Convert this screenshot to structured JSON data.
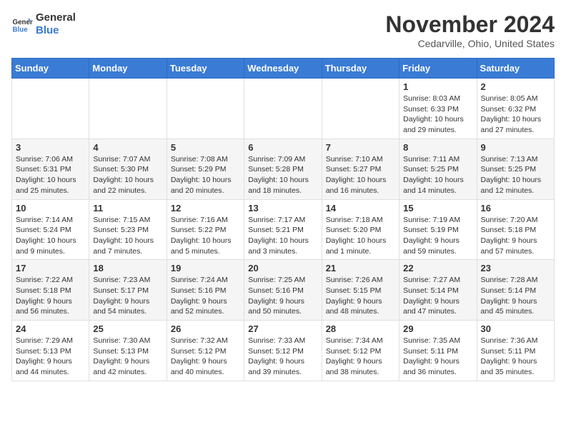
{
  "logo": {
    "text_general": "General",
    "text_blue": "Blue"
  },
  "header": {
    "month_year": "November 2024",
    "location": "Cedarville, Ohio, United States"
  },
  "weekdays": [
    "Sunday",
    "Monday",
    "Tuesday",
    "Wednesday",
    "Thursday",
    "Friday",
    "Saturday"
  ],
  "weeks": [
    [
      {
        "day": "",
        "info": ""
      },
      {
        "day": "",
        "info": ""
      },
      {
        "day": "",
        "info": ""
      },
      {
        "day": "",
        "info": ""
      },
      {
        "day": "",
        "info": ""
      },
      {
        "day": "1",
        "info": "Sunrise: 8:03 AM\nSunset: 6:33 PM\nDaylight: 10 hours and 29 minutes."
      },
      {
        "day": "2",
        "info": "Sunrise: 8:05 AM\nSunset: 6:32 PM\nDaylight: 10 hours and 27 minutes."
      }
    ],
    [
      {
        "day": "3",
        "info": "Sunrise: 7:06 AM\nSunset: 5:31 PM\nDaylight: 10 hours and 25 minutes."
      },
      {
        "day": "4",
        "info": "Sunrise: 7:07 AM\nSunset: 5:30 PM\nDaylight: 10 hours and 22 minutes."
      },
      {
        "day": "5",
        "info": "Sunrise: 7:08 AM\nSunset: 5:29 PM\nDaylight: 10 hours and 20 minutes."
      },
      {
        "day": "6",
        "info": "Sunrise: 7:09 AM\nSunset: 5:28 PM\nDaylight: 10 hours and 18 minutes."
      },
      {
        "day": "7",
        "info": "Sunrise: 7:10 AM\nSunset: 5:27 PM\nDaylight: 10 hours and 16 minutes."
      },
      {
        "day": "8",
        "info": "Sunrise: 7:11 AM\nSunset: 5:25 PM\nDaylight: 10 hours and 14 minutes."
      },
      {
        "day": "9",
        "info": "Sunrise: 7:13 AM\nSunset: 5:25 PM\nDaylight: 10 hours and 12 minutes."
      }
    ],
    [
      {
        "day": "10",
        "info": "Sunrise: 7:14 AM\nSunset: 5:24 PM\nDaylight: 10 hours and 9 minutes."
      },
      {
        "day": "11",
        "info": "Sunrise: 7:15 AM\nSunset: 5:23 PM\nDaylight: 10 hours and 7 minutes."
      },
      {
        "day": "12",
        "info": "Sunrise: 7:16 AM\nSunset: 5:22 PM\nDaylight: 10 hours and 5 minutes."
      },
      {
        "day": "13",
        "info": "Sunrise: 7:17 AM\nSunset: 5:21 PM\nDaylight: 10 hours and 3 minutes."
      },
      {
        "day": "14",
        "info": "Sunrise: 7:18 AM\nSunset: 5:20 PM\nDaylight: 10 hours and 1 minute."
      },
      {
        "day": "15",
        "info": "Sunrise: 7:19 AM\nSunset: 5:19 PM\nDaylight: 9 hours and 59 minutes."
      },
      {
        "day": "16",
        "info": "Sunrise: 7:20 AM\nSunset: 5:18 PM\nDaylight: 9 hours and 57 minutes."
      }
    ],
    [
      {
        "day": "17",
        "info": "Sunrise: 7:22 AM\nSunset: 5:18 PM\nDaylight: 9 hours and 56 minutes."
      },
      {
        "day": "18",
        "info": "Sunrise: 7:23 AM\nSunset: 5:17 PM\nDaylight: 9 hours and 54 minutes."
      },
      {
        "day": "19",
        "info": "Sunrise: 7:24 AM\nSunset: 5:16 PM\nDaylight: 9 hours and 52 minutes."
      },
      {
        "day": "20",
        "info": "Sunrise: 7:25 AM\nSunset: 5:16 PM\nDaylight: 9 hours and 50 minutes."
      },
      {
        "day": "21",
        "info": "Sunrise: 7:26 AM\nSunset: 5:15 PM\nDaylight: 9 hours and 48 minutes."
      },
      {
        "day": "22",
        "info": "Sunrise: 7:27 AM\nSunset: 5:14 PM\nDaylight: 9 hours and 47 minutes."
      },
      {
        "day": "23",
        "info": "Sunrise: 7:28 AM\nSunset: 5:14 PM\nDaylight: 9 hours and 45 minutes."
      }
    ],
    [
      {
        "day": "24",
        "info": "Sunrise: 7:29 AM\nSunset: 5:13 PM\nDaylight: 9 hours and 44 minutes."
      },
      {
        "day": "25",
        "info": "Sunrise: 7:30 AM\nSunset: 5:13 PM\nDaylight: 9 hours and 42 minutes."
      },
      {
        "day": "26",
        "info": "Sunrise: 7:32 AM\nSunset: 5:12 PM\nDaylight: 9 hours and 40 minutes."
      },
      {
        "day": "27",
        "info": "Sunrise: 7:33 AM\nSunset: 5:12 PM\nDaylight: 9 hours and 39 minutes."
      },
      {
        "day": "28",
        "info": "Sunrise: 7:34 AM\nSunset: 5:12 PM\nDaylight: 9 hours and 38 minutes."
      },
      {
        "day": "29",
        "info": "Sunrise: 7:35 AM\nSunset: 5:11 PM\nDaylight: 9 hours and 36 minutes."
      },
      {
        "day": "30",
        "info": "Sunrise: 7:36 AM\nSunset: 5:11 PM\nDaylight: 9 hours and 35 minutes."
      }
    ]
  ]
}
